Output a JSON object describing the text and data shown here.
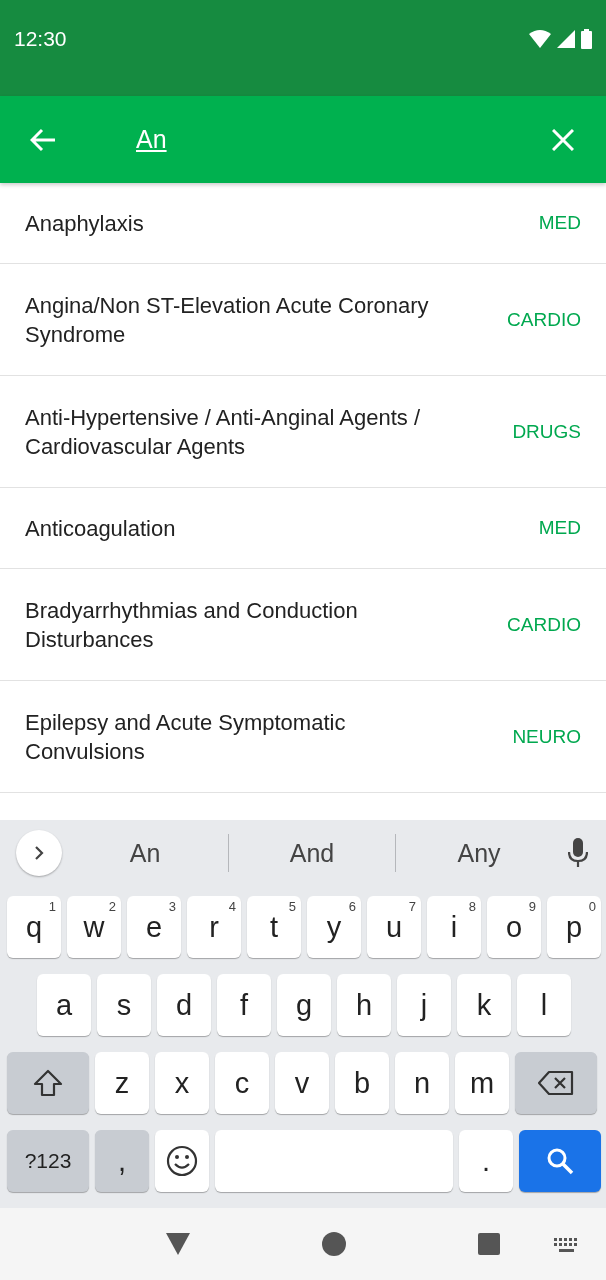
{
  "status_bar": {
    "time": "12:30"
  },
  "search_bar": {
    "value": "An"
  },
  "results": [
    {
      "title": "Anaphylaxis",
      "category": "MED"
    },
    {
      "title": "Angina/Non ST-Elevation Acute Coronary Syndrome",
      "category": "CARDIO"
    },
    {
      "title": "Anti-Hypertensive / Anti-Anginal Agents / Cardiovascular Agents",
      "category": "DRUGS"
    },
    {
      "title": "Anticoagulation",
      "category": "MED"
    },
    {
      "title": "Bradyarrhythmias and Conduction Disturbances",
      "category": "CARDIO"
    },
    {
      "title": "Epilepsy and Acute Symptomatic Convulsions",
      "category": "NEURO"
    }
  ],
  "keyboard": {
    "suggestions": [
      "An",
      "And",
      "Any"
    ],
    "rows": [
      {
        "keys": [
          {
            "kind": "letter",
            "label": "q",
            "hint": "1"
          },
          {
            "kind": "letter",
            "label": "w",
            "hint": "2"
          },
          {
            "kind": "letter",
            "label": "e",
            "hint": "3"
          },
          {
            "kind": "letter",
            "label": "r",
            "hint": "4"
          },
          {
            "kind": "letter",
            "label": "t",
            "hint": "5"
          },
          {
            "kind": "letter",
            "label": "y",
            "hint": "6"
          },
          {
            "kind": "letter",
            "label": "u",
            "hint": "7"
          },
          {
            "kind": "letter",
            "label": "i",
            "hint": "8"
          },
          {
            "kind": "letter",
            "label": "o",
            "hint": "9"
          },
          {
            "kind": "letter",
            "label": "p",
            "hint": "0"
          }
        ]
      },
      {
        "keys": [
          {
            "kind": "letter",
            "label": "a"
          },
          {
            "kind": "letter",
            "label": "s"
          },
          {
            "kind": "letter",
            "label": "d"
          },
          {
            "kind": "letter",
            "label": "f"
          },
          {
            "kind": "letter",
            "label": "g"
          },
          {
            "kind": "letter",
            "label": "h"
          },
          {
            "kind": "letter",
            "label": "j"
          },
          {
            "kind": "letter",
            "label": "k"
          },
          {
            "kind": "letter",
            "label": "l"
          }
        ]
      },
      {
        "keys": [
          {
            "kind": "shift"
          },
          {
            "kind": "letter",
            "label": "z"
          },
          {
            "kind": "letter",
            "label": "x"
          },
          {
            "kind": "letter",
            "label": "c"
          },
          {
            "kind": "letter",
            "label": "v"
          },
          {
            "kind": "letter",
            "label": "b"
          },
          {
            "kind": "letter",
            "label": "n"
          },
          {
            "kind": "letter",
            "label": "m"
          },
          {
            "kind": "backspace"
          }
        ]
      },
      {
        "keys": [
          {
            "kind": "symbols",
            "label": "?123"
          },
          {
            "kind": "punct",
            "label": ","
          },
          {
            "kind": "emoji"
          },
          {
            "kind": "space"
          },
          {
            "kind": "period",
            "label": "."
          },
          {
            "kind": "search"
          }
        ]
      }
    ]
  }
}
